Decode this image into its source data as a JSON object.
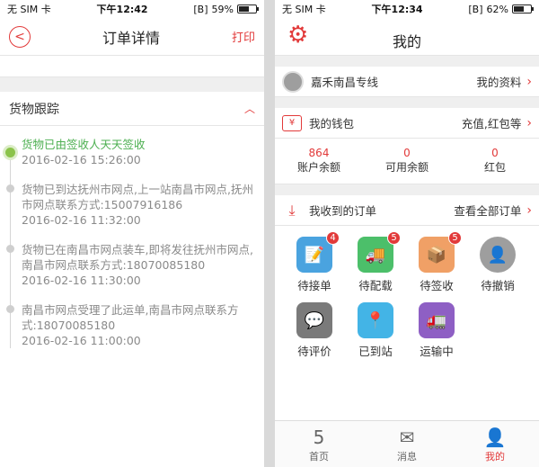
{
  "left": {
    "status": {
      "carrier": "无 SIM 卡",
      "time": "下午12:42",
      "bt": "[B]",
      "battery": "59%",
      "battery_level": 0.59
    },
    "nav": {
      "back_glyph": "<",
      "title": "订单详情",
      "print": "打印"
    },
    "tracking": {
      "title": "货物跟踪",
      "items": [
        {
          "text": "货物已由签收人天天签收",
          "time": "2016-02-16 15:26:00"
        },
        {
          "text": "货物已到达抚州市网点,上一站南昌市网点,抚州市网点联系方式:15007916186",
          "time": "2016-02-16 11:32:00"
        },
        {
          "text": "货物已在南昌市网点装车,即将发往抚州市网点,南昌市网点联系方式:18070085180",
          "time": "2016-02-16 11:30:00"
        },
        {
          "text": "南昌市网点受理了此运单,南昌市网点联系方式:18070085180",
          "time": "2016-02-16 11:00:00"
        }
      ]
    }
  },
  "right": {
    "status": {
      "carrier": "无 SIM 卡",
      "time": "下午12:34",
      "bt": "[B]",
      "battery": "62%",
      "battery_level": 0.62
    },
    "title": "我的",
    "profile": {
      "name": "嘉禾南昌专线",
      "link": "我的资料"
    },
    "wallet": {
      "label": "我的钱包",
      "link": "充值,红包等",
      "icon": "¥"
    },
    "balances": [
      {
        "value": "864",
        "label": "账户余额"
      },
      {
        "value": "0",
        "label": "可用余额"
      },
      {
        "value": "0",
        "label": "红包"
      }
    ],
    "orders": {
      "label": "我收到的订单",
      "link": "查看全部订单"
    },
    "grid": [
      {
        "label": "待接单",
        "badge": "4",
        "color": "#4aa3df",
        "icon": "📝"
      },
      {
        "label": "待配载",
        "badge": "5",
        "color": "#4cbf6a",
        "icon": "🚚"
      },
      {
        "label": "待签收",
        "badge": "5",
        "color": "#f0a066",
        "icon": "📦"
      },
      {
        "label": "待撤销",
        "badge": "",
        "color": "#9e9e9e",
        "icon": "👤"
      },
      {
        "label": "待评价",
        "badge": "",
        "color": "#7a7a7a",
        "icon": "💬"
      },
      {
        "label": "已到站",
        "badge": "",
        "color": "#43b4e6",
        "icon": "📍"
      },
      {
        "label": "运输中",
        "badge": "",
        "color": "#8e5fc4",
        "icon": "🚛"
      }
    ],
    "tabs": [
      {
        "label": "首页",
        "icon": "5"
      },
      {
        "label": "消息",
        "icon": "✉"
      },
      {
        "label": "我的",
        "icon": "👤"
      }
    ]
  }
}
